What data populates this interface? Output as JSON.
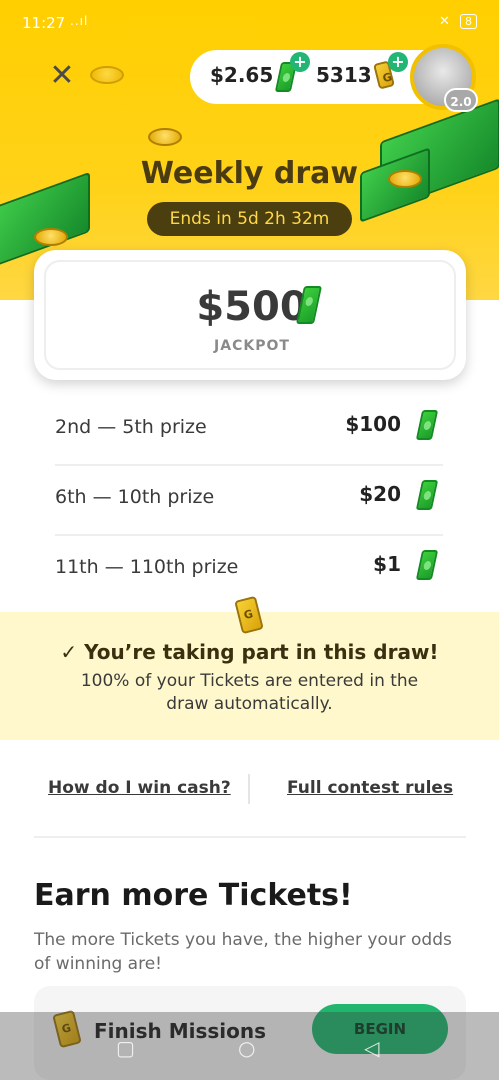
{
  "status_bar": {
    "time": "11:27",
    "signal": "..ıl",
    "battery": "8"
  },
  "header": {
    "close_icon": "close-icon",
    "cash_balance": "$2.65",
    "ticket_balance": "5313",
    "avatar_level": "2.0",
    "title": "Weekly draw",
    "ends_in": "Ends in 5d 2h 32m"
  },
  "jackpot": {
    "amount": "$500",
    "label": "JACKPOT"
  },
  "prizes": [
    {
      "name": "2nd — 5th prize",
      "value": "$100"
    },
    {
      "name": "6th — 10th prize",
      "value": "$20"
    },
    {
      "name": "11th — 110th prize",
      "value": "$1"
    }
  ],
  "participation": {
    "title": "You’re taking part in this draw!",
    "text": "100% of your Tickets are entered in the draw automatically."
  },
  "links": {
    "how_to_win": "How do I win cash?",
    "rules": "Full contest rules"
  },
  "earn": {
    "title": "Earn more Tickets!",
    "subtitle": "The more Tickets you have, the higher your odds of winning are!"
  },
  "mission": {
    "label": "Finish Missions",
    "button": "BEGIN"
  },
  "colors": {
    "hero": "#ffcf00",
    "accent_green": "#21b56e",
    "banner": "#fff8cc"
  }
}
